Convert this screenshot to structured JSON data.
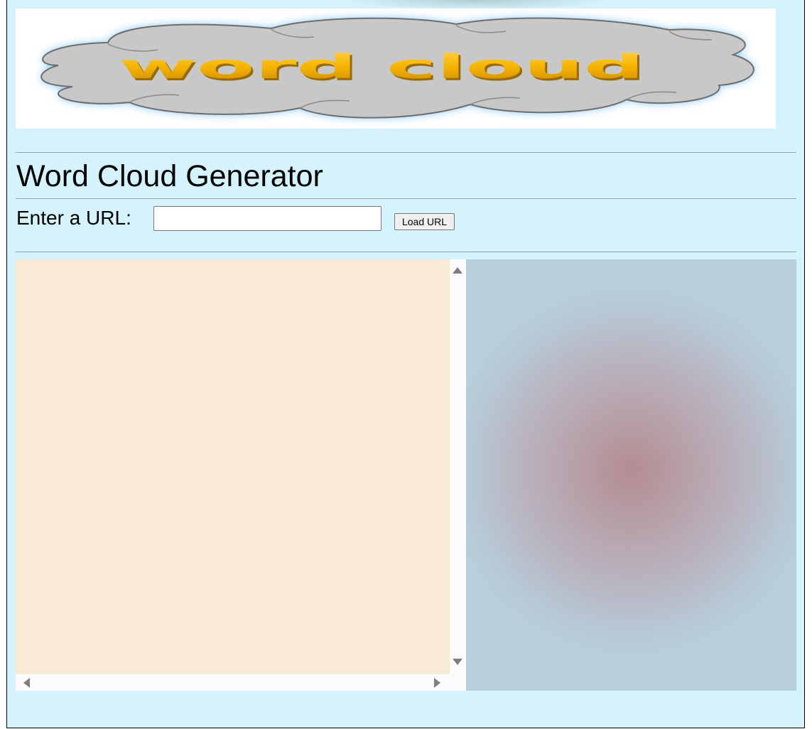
{
  "banner": {
    "logo_text": "word cloud",
    "colors": {
      "cloud": "#c8c8c8",
      "glow": "#7ec3f5",
      "letters": "#f6b400"
    }
  },
  "header": {
    "title": "Word Cloud Generator"
  },
  "url_form": {
    "label": "Enter a URL:",
    "input_value": "",
    "button_label": "Load URL"
  },
  "text_panel": {
    "content": "",
    "background": "#f8ead7"
  },
  "cloud_panel": {
    "background": "#b7cedb",
    "center_color": "#b48c93"
  }
}
